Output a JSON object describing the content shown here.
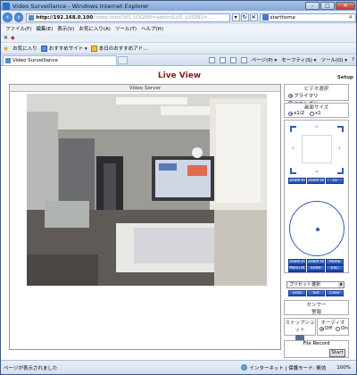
{
  "window": {
    "title": "Video Surveillance - Windows Internet Explorer",
    "min": "–",
    "max": "□",
    "close": "✕"
  },
  "address": {
    "url_host": "http://192.168.0.100",
    "url_path": "/index.html?ViS_LOGIN0=admin&LIS_LOGIN1=...",
    "refresh": "↻",
    "stop": "✕",
    "search_text": "starthome"
  },
  "menu": [
    "ファイル(F)",
    "編集(E)",
    "表示(V)",
    "お気に入り(A)",
    "ツール(T)",
    "ヘルプ(H)"
  ],
  "toolbar_row": {
    "close": "✕",
    "icon": "◆"
  },
  "favorites": {
    "label": "お気に入り",
    "items": [
      "おすすめサイト ▾",
      "本日のおすすめアド..."
    ]
  },
  "tab": {
    "title": "Video Surveillance"
  },
  "commandbar": [
    "ページ(P) ▾",
    "セーフティ(S) ▾",
    "ツール(O) ▾",
    "?"
  ],
  "page": {
    "heading": "Live View",
    "setup_link": "Setup",
    "video_header": "Video Server"
  },
  "panel": {
    "video_select": {
      "title": "ビデオ選択",
      "options": [
        "プライマリ",
        "セカンダリ"
      ],
      "selected": 0
    },
    "screen_size": {
      "title": "画面サイズ",
      "options": [
        "x1/2",
        "x1"
      ],
      "selected": 0
    },
    "zoom_buttons": [
      "Zoom In",
      "Zoom Out",
      "1x"
    ],
    "ptz_buttons_row1": [
      "Zoom In",
      "Zoom Out",
      "Home"
    ],
    "ptz_buttons_row2": [
      "Focus Near",
      "Focus Far",
      "Auto Focus"
    ],
    "ptz_buttons_row3": [
      "Menu Btn",
      "Enter",
      "ESC"
    ],
    "preset": {
      "placeholder": "プリセット選択",
      "buttons": [
        "Goto",
        "Set",
        "Clear"
      ]
    },
    "sensor": {
      "title": "センサー",
      "alarm": "警報"
    },
    "snapshot": {
      "title": "スナップショット"
    },
    "audio": {
      "title": "オーディオ",
      "options": [
        "Off",
        "On"
      ],
      "selected": 0
    },
    "file_record": {
      "title": "File Record",
      "start": "Start"
    }
  },
  "status": {
    "text": "ページが表示されました",
    "zone": "インターネット | 保護モード: 無効",
    "zoom": "100%"
  }
}
